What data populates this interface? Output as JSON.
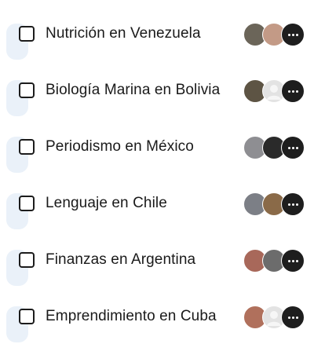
{
  "groups": [
    {
      "name": "Nutrición en Venezuela",
      "avatars": [
        "photo-avatar",
        "photo-avatar"
      ],
      "colors": [
        "#6b6559",
        "#c39a86"
      ]
    },
    {
      "name": "Biología Marina en Bolivia",
      "avatars": [
        "photo-avatar",
        "default-avatar"
      ],
      "colors": [
        "#5d5444",
        "#dcdcdc"
      ]
    },
    {
      "name": "Periodismo en México",
      "avatars": [
        "photo-avatar",
        "photo-avatar"
      ],
      "colors": [
        "#8e8e92",
        "#2a2a2a"
      ]
    },
    {
      "name": "Lenguaje en Chile",
      "avatars": [
        "photo-avatar",
        "photo-avatar"
      ],
      "colors": [
        "#7c7f86",
        "#8a6a48"
      ]
    },
    {
      "name": "Finanzas en Argentina",
      "avatars": [
        "photo-avatar",
        "photo-avatar"
      ],
      "colors": [
        "#a8685a",
        "#6c6c6c"
      ]
    },
    {
      "name": "Emprendimiento en Cuba",
      "avatars": [
        "photo-avatar",
        "default-avatar"
      ],
      "colors": [
        "#b0705c",
        "#dcdcdc"
      ]
    }
  ],
  "more_icon": "more-dots-icon"
}
